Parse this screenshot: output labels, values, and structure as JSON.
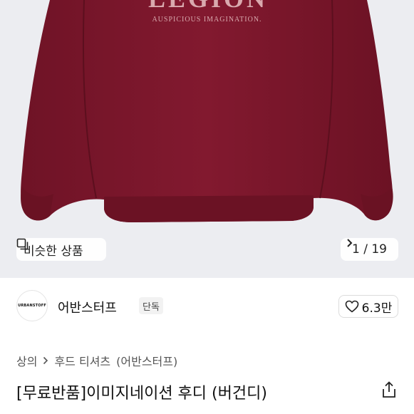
{
  "hero": {
    "product_image": "burgundy-sweatshirt-photo",
    "print_large": "LEGION",
    "print_small": "AUSPICIOUS IMAGINATION.",
    "similar_button": {
      "label": "비슷한 상품",
      "icon": "similar-items-icon"
    },
    "counter": {
      "text": "1 / 19",
      "icon": "chevron-right-icon"
    }
  },
  "shop": {
    "logo_text": "URBANSTOFF",
    "logo_subtext": "",
    "name": "어반스터프",
    "badge": "단독",
    "likes": {
      "count": "6.3만",
      "icon": "heart-icon"
    }
  },
  "breadcrumb": {
    "category": "상의",
    "subcategory": "후드 티셔츠",
    "brand": "(어반스터프)"
  },
  "product": {
    "title": "[무료반품]이미지네이션 후디 (버건디)"
  },
  "colors": {
    "sweatshirt": "#7e1a2e",
    "hero_background": "#ecedf1",
    "print": "#d9a9ae"
  }
}
